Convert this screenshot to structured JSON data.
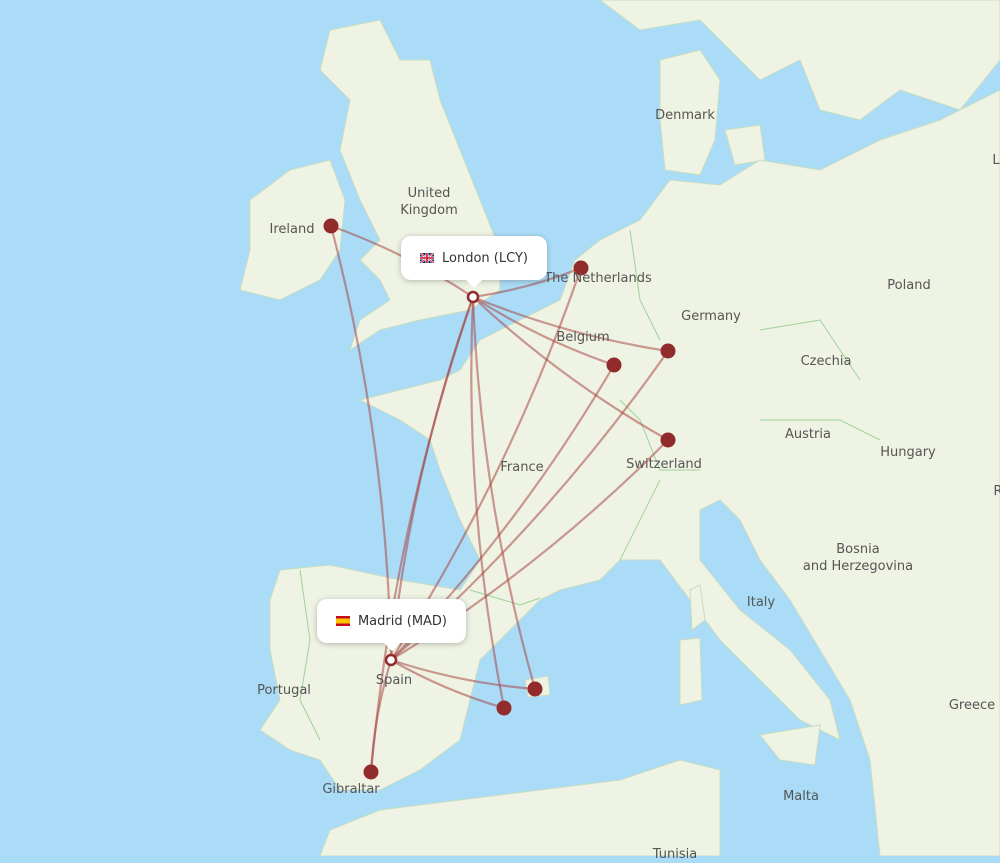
{
  "colors": {
    "water": "#aadcf7",
    "land": "#eef3e3",
    "route": "#a33a3a",
    "dot": "#922b2b"
  },
  "airports": {
    "origin": {
      "label": "London (LCY)",
      "flag_icon": "uk-flag-icon"
    },
    "destination": {
      "label": "Madrid (MAD)",
      "flag_icon": "spain-flag-icon"
    }
  },
  "countries": [
    "Denmark",
    "United Kingdom",
    "Ireland",
    "The Netherlands",
    "Germany",
    "Poland",
    "Belgium",
    "Czechia",
    "France",
    "Austria",
    "Hungary",
    "Switzerland",
    "Bosnia and Herzegovina",
    "Italy",
    "Portugal",
    "Spain",
    "Gibraltar",
    "Malta",
    "Greece",
    "Tunisia",
    "L",
    "R"
  ]
}
